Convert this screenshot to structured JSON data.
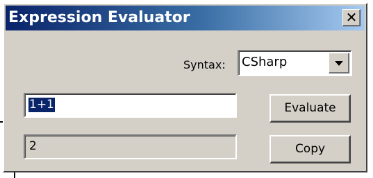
{
  "window": {
    "title": "Expression Evaluator",
    "close_glyph": "✕"
  },
  "syntax": {
    "label": "Syntax:",
    "selected": "CSharp"
  },
  "expression": {
    "value": "1+1"
  },
  "result": {
    "value": "2"
  },
  "buttons": {
    "evaluate_label": "Evaluate",
    "copy_label": "Copy"
  },
  "colors": {
    "titlebar_start": "#0a246a",
    "titlebar_end": "#a6caf0",
    "face": "#d4d0c8",
    "selection": "#0a246a"
  },
  "icons": {
    "close": "close-icon",
    "dropdown": "chevron-down-icon"
  }
}
